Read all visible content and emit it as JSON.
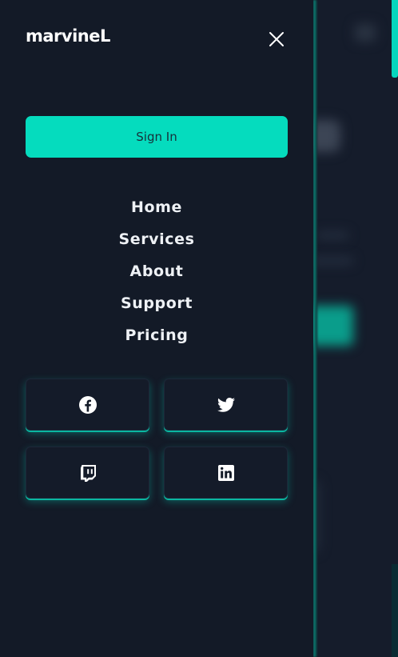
{
  "brand": {
    "logo_text": "marvineL"
  },
  "drawer": {
    "signin_label": "Sign In",
    "nav_items": [
      {
        "label": "Home"
      },
      {
        "label": "Services"
      },
      {
        "label": "About"
      },
      {
        "label": "Support"
      },
      {
        "label": "Pricing"
      }
    ],
    "social_links": [
      {
        "icon": "facebook-icon"
      },
      {
        "icon": "twitter-icon"
      },
      {
        "icon": "twitch-icon"
      },
      {
        "icon": "linkedin-icon"
      }
    ],
    "close_icon": "close-icon"
  },
  "colors": {
    "background": "#131a27",
    "accent": "#05dcbe",
    "text": "#eef1f5",
    "button_text": "#17303a"
  }
}
